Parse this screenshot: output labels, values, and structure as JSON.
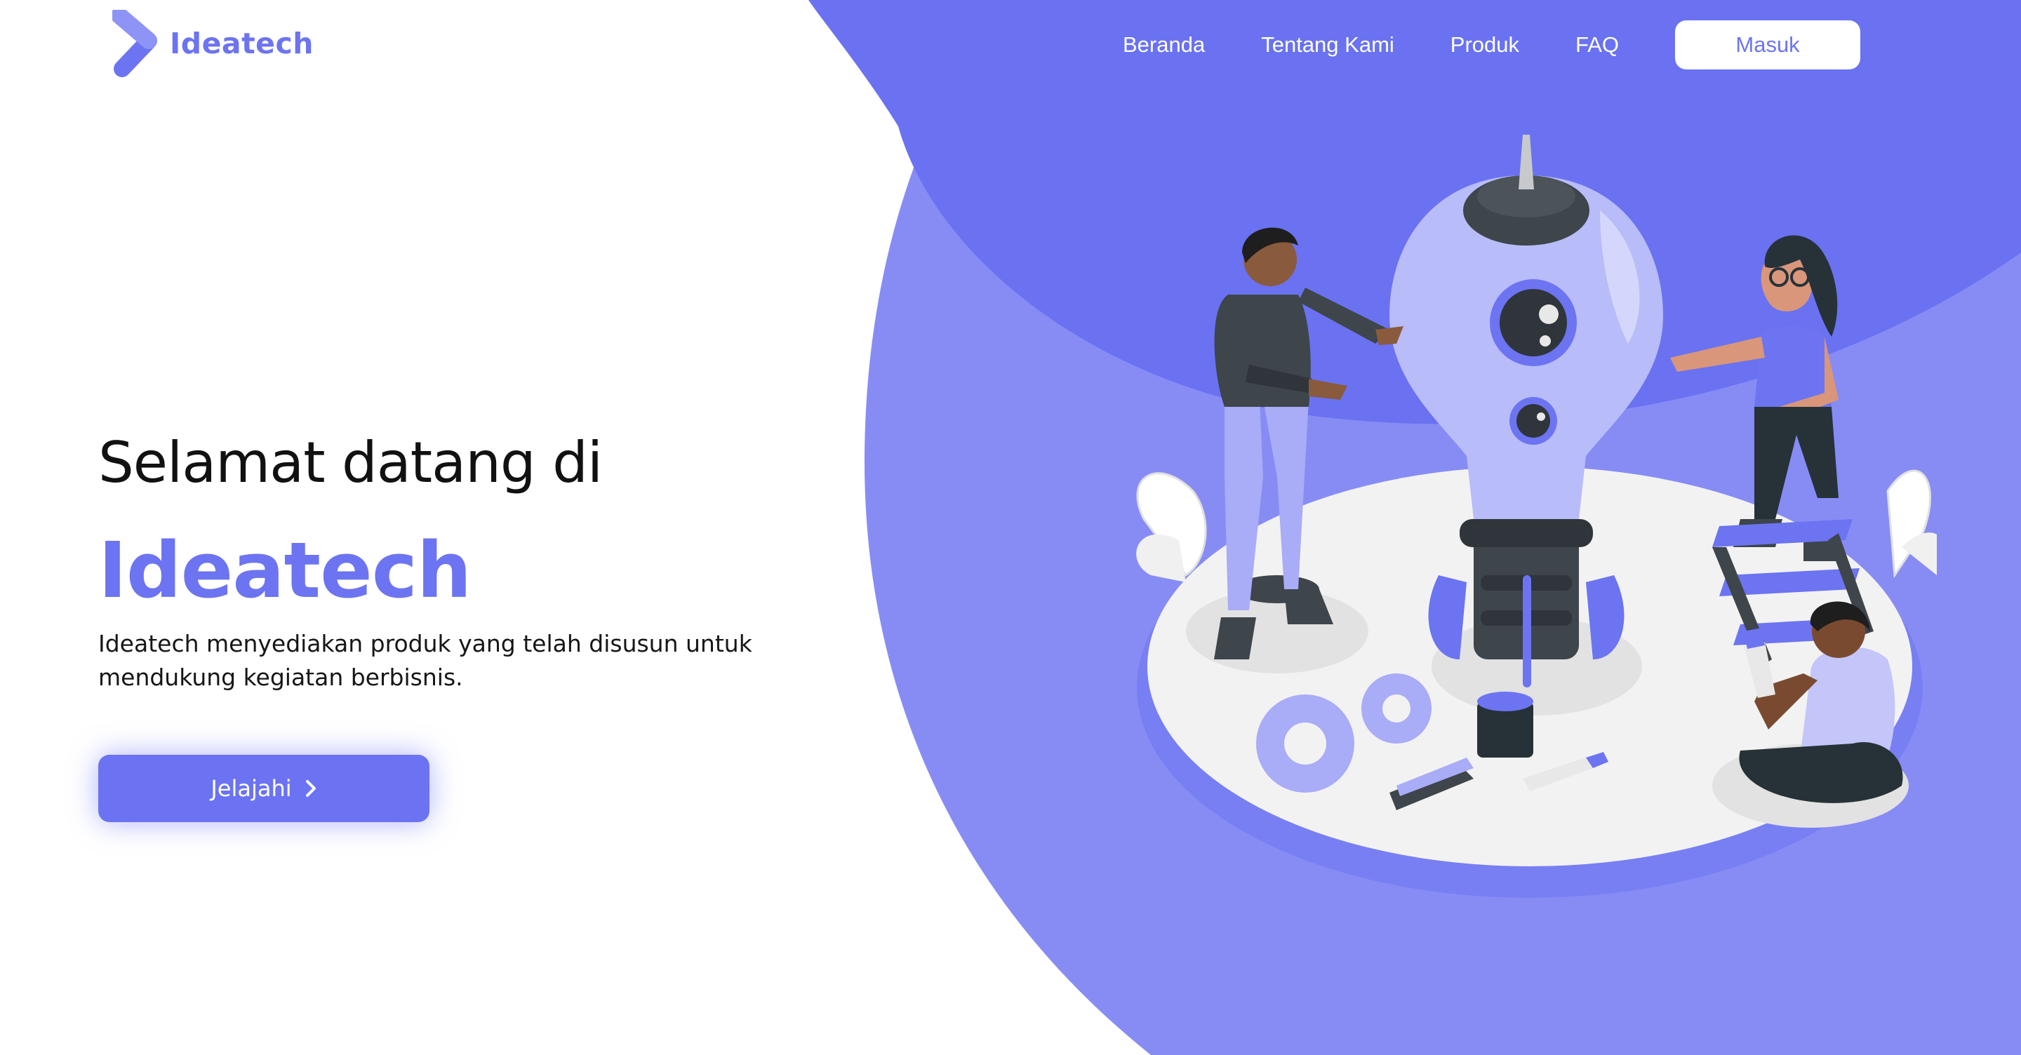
{
  "brand": {
    "name": "Ideatech",
    "color": "#6c74f1"
  },
  "nav": {
    "links": [
      "Beranda",
      "Tentang Kami",
      "Produk",
      "FAQ"
    ],
    "login_label": "Masuk"
  },
  "hero": {
    "welcome": "Selamat datang di",
    "brand_name": "Ideatech",
    "description": "Ideatech menyediakan produk yang telah disusun untuk mendukung kegiatan berbisnis.",
    "cta_label": "Jelajahi"
  },
  "colors": {
    "primary": "#6c74f1",
    "primary_light": "#878cf5",
    "text_dark": "#111111",
    "background": "#ffffff"
  },
  "icons": {
    "logo": "chevron-logo-icon",
    "cta": "chevron-right-icon"
  }
}
